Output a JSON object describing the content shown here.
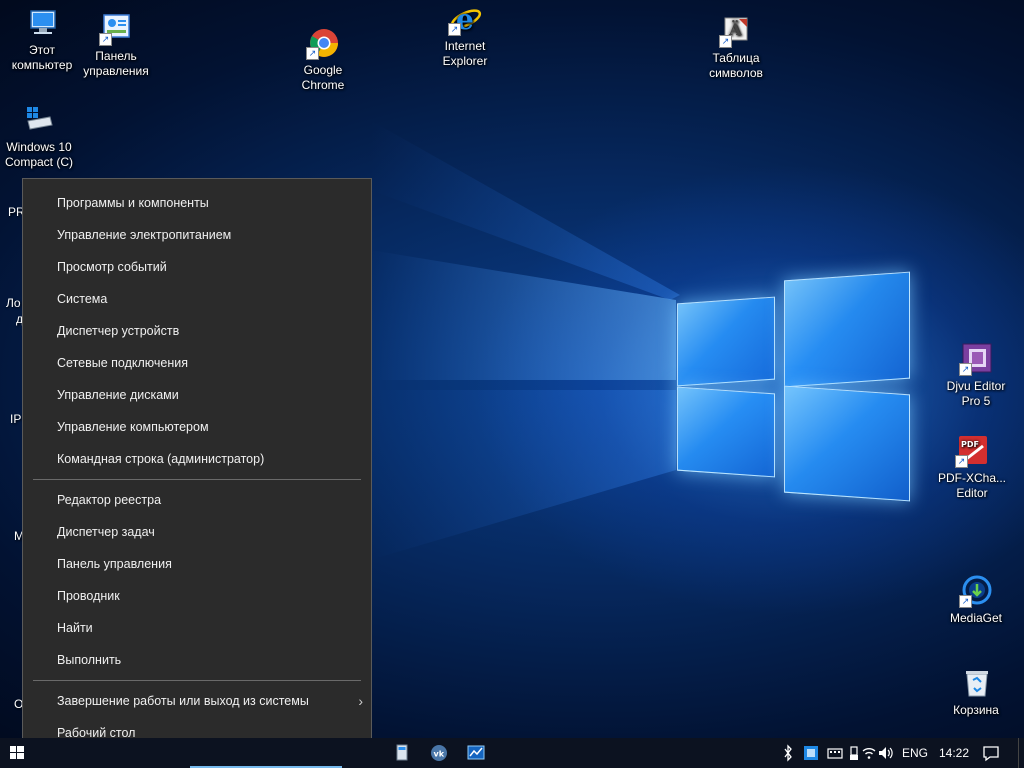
{
  "desktop_icons": {
    "this_pc": {
      "line1": "Этот",
      "line2": "компьютер"
    },
    "control_panel": {
      "line1": "Панель",
      "line2": "управления"
    },
    "chrome": {
      "line1": "Google",
      "line2": "Chrome"
    },
    "ie": {
      "line1": "Internet",
      "line2": "Explorer"
    },
    "charmap": {
      "line1": "Таблица",
      "line2": "символов"
    },
    "drive_c": {
      "line1": "Windows 10",
      "line2": "Compact (C)"
    },
    "djvu": {
      "line1": "Djvu Editor",
      "line2": "Pro 5"
    },
    "pdfx": {
      "line1": "PDF-XCha...",
      "line2": "Editor"
    },
    "mediaget": {
      "line1": "MediaGet"
    },
    "recycle": {
      "line1": "Корзина"
    }
  },
  "partial_labels": {
    "pr": "PR",
    "lo": "Ло",
    "a": "д",
    "ip": "IP",
    "m": "M",
    "o": "O"
  },
  "menu": {
    "group1": [
      "Программы и компоненты",
      "Управление электропитанием",
      "Просмотр событий",
      "Система",
      "Диспетчер устройств",
      "Сетевые подключения",
      "Управление дисками",
      "Управление компьютером",
      "Командная строка (администратор)"
    ],
    "group2": [
      "Редактор реестра",
      "Диспетчер задач",
      "Панель управления",
      "Проводник",
      "Найти",
      "Выполнить"
    ],
    "shutdown": "Завершение работы или выход из системы",
    "desktop": "Рабочий стол",
    "chevron": "›"
  },
  "taskbar": {
    "lang": "ENG",
    "time": "14:22"
  },
  "colors": {
    "menu_bg": "#2b2b2b",
    "menu_text": "#f0f0f0",
    "taskbar_bg": "#0c1220",
    "accent": "#1a8cff"
  }
}
